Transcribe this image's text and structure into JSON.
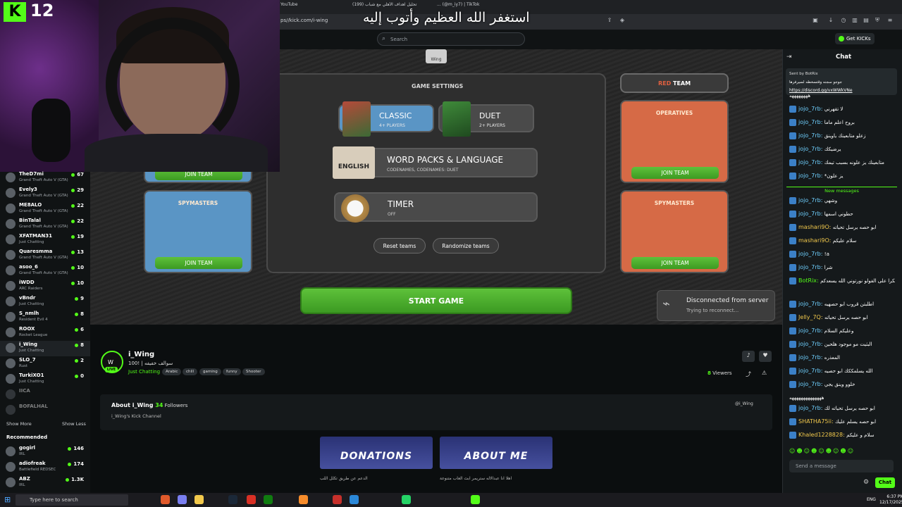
{
  "browser": {
    "tabs": [
      "YouTube",
      "(199) تحليل اهداف الأهلي مع شباب",
      "... (@m_iy7) | TikTok"
    ],
    "url": "ps//kick.com/i-wing"
  },
  "overlay": {
    "badge": "12",
    "arabic_caption": "استغفر الله العظيم وأتوب إليه"
  },
  "kick_header": {
    "search_placeholder": "Search",
    "get_kicks": "Get KICKs"
  },
  "sidebar": {
    "following": [
      {
        "name": "TheD7mi",
        "game": "Grand Theft Auto V (GTA)",
        "count": "67"
      },
      {
        "name": "Evely3",
        "game": "Grand Theft Auto V (GTA)",
        "count": "29"
      },
      {
        "name": "ME8ALO",
        "game": "Grand Theft Auto V (GTA)",
        "count": "22"
      },
      {
        "name": "BinTalal",
        "game": "Grand Theft Auto V (GTA)",
        "count": "22"
      },
      {
        "name": "XFATMAN31",
        "game": "Just Chatting",
        "count": "19"
      },
      {
        "name": "Quaresmma",
        "game": "Grand Theft Auto V (GTA)",
        "count": "13"
      },
      {
        "name": "asoo_6",
        "game": "Grand Theft Auto V (GTA)",
        "count": "10"
      },
      {
        "name": "iWDD",
        "game": "ARC Raiders",
        "count": "10"
      },
      {
        "name": "vBndr",
        "game": "Just Chatting",
        "count": "9"
      },
      {
        "name": "S_nmlh",
        "game": "Resident Evil 4",
        "count": "8"
      },
      {
        "name": "ROOX",
        "game": "Rocket League",
        "count": "6"
      },
      {
        "name": "i_Wing",
        "game": "Just Chatting",
        "count": "8"
      },
      {
        "name": "SLO_7",
        "game": "Rust",
        "count": "2"
      },
      {
        "name": "TurkiXO1",
        "game": "Just Chatting",
        "count": "0"
      },
      {
        "name": "IICA",
        "game": "",
        "count": ""
      },
      {
        "name": "BOFALHAL",
        "game": "",
        "count": ""
      }
    ],
    "show_more": "Show More",
    "show_less": "Show Less",
    "recommended_title": "Recommended",
    "recommended": [
      {
        "name": "gogirl",
        "game": "IRL",
        "count": "146"
      },
      {
        "name": "adiofreak",
        "game": "Battlefield REDSEC",
        "count": "174"
      },
      {
        "name": "ABZ",
        "game": "IRL",
        "count": "1.3K"
      }
    ]
  },
  "game": {
    "wing_tag": "Wing",
    "settings_title": "GAME SETTINGS",
    "modes": [
      {
        "label": "CLASSIC",
        "sub": "4+ PLAYERS"
      },
      {
        "label": "DUET",
        "sub": "2+ PLAYERS"
      }
    ],
    "word_packs": {
      "label": "WORD PACKS & LANGUAGE",
      "sub": "CODENAMES, CODENAMES: DUET",
      "lang": "ENGLISH"
    },
    "timer": {
      "label": "TIMER",
      "sub": "OFF"
    },
    "reset": "Reset teams",
    "randomize": "Randomize teams",
    "start": "START GAME",
    "red_team": {
      "prefix": "RED",
      "suffix": " TEAM"
    },
    "blue_join_top": "JOIN TEAM",
    "blue_spymasters": "SPYMASTERS",
    "red_operatives": "OPERATIVES",
    "red_spymasters": "SPYMASTERS",
    "join": "JOIN TEAM",
    "disconnected_title": "Disconnected from server",
    "disconnected_sub": "Trying to reconnect..."
  },
  "stream": {
    "channel": "i_Wing",
    "title": "سوالف خفيفه | !100",
    "category": "Just Chatting",
    "tags": [
      "Arabic",
      "chill",
      "gaming",
      "funny",
      "Shooter"
    ],
    "live": "LIVE",
    "viewers_count": "8",
    "viewers_label": " Viewers",
    "about_prefix": "About i_Wing",
    "followers_count": "34",
    "followers_label": " Followers",
    "about_desc": "i_Wing's Kick Channel",
    "social": "@i_Wing",
    "panels": [
      {
        "title": "DONATIONS",
        "caption": "الدعم عن طريق تكلل اللب"
      },
      {
        "title": "ABOUT ME",
        "caption": "اهلا انا عبدالاله ستريمر ابث العاب متنوعة"
      }
    ]
  },
  "chat": {
    "title": "Chat",
    "pinned_by": "Sent by BotRix",
    "pinned_text": "جوجو سجنه وقتسخطه لسيرفرها",
    "pinned_link": "https://discord.gg/vxWWkVNe",
    "new_messages": "New messages",
    "messages": [
      {
        "user": "",
        "text": "ههههههههه"
      },
      {
        "user": "jojo_7rb:",
        "text": "لا تقهرني"
      },
      {
        "user": "jojo_7rb:",
        "text": "بروح اعلم ماما"
      },
      {
        "user": "jojo_7rb:",
        "text": "زعلو متابعينك ياوينق"
      },
      {
        "user": "jojo_7rb:",
        "text": "يرضيكك"
      },
      {
        "user": "jojo_7rb:",
        "text": "متابعينك يز علونه بسبب تيمك"
      },
      {
        "user": "jojo_7rb:",
        "text": "*يز علون"
      },
      {
        "user": "jojo_7rb:",
        "text": "وشهي"
      },
      {
        "user": "jojo_7rb:",
        "text": "حطوني اسمها"
      },
      {
        "user": "mashari9O:",
        "text": "ابو حصه يرسل تحياته"
      },
      {
        "user": "mashari9O:",
        "text": "سلام عليكم"
      },
      {
        "user": "jojo_7rb:",
        "text": "!a"
      },
      {
        "user": "jojo_7rb:",
        "text": "شرا"
      },
      {
        "user": "BotRix:",
        "text": "شكرا على الفولو نورتوني الله يسعدكم"
      },
      {
        "user": "jojo_7rb:",
        "text": "اطلبتن قروب ابو حصهيه"
      },
      {
        "user": "Jelly_7Q:",
        "text": "ابو حصه يرسل تحياته"
      },
      {
        "user": "jojo_7rb:",
        "text": "وعليكم السلام"
      },
      {
        "user": "jojo_7rb:",
        "text": "البثيت مو موجود هلحين"
      },
      {
        "user": "jojo_7rb:",
        "text": "المعذره"
      },
      {
        "user": "jojo_7rb:",
        "text": "الله يسلمككك ابو حصيه"
      },
      {
        "user": "jojo_7rb:",
        "text": "خلوو وينق يجي"
      },
      {
        "user": "",
        "text": "ههههههههههههههه"
      },
      {
        "user": "jojo_7rb:",
        "text": "ابو حصه يرسل تحياته لك"
      },
      {
        "user": "SHATHA75ii:",
        "text": "ابو حصه يسلم عليك"
      },
      {
        "user": "Khaled1228828:",
        "text": "سلام و عليكم"
      }
    ],
    "input_placeholder": "Send a message",
    "send": "Chat"
  },
  "taskbar": {
    "search": "Type here to search",
    "lang": "ENG",
    "time": "6:37 PM",
    "date": "12/17/2025"
  }
}
